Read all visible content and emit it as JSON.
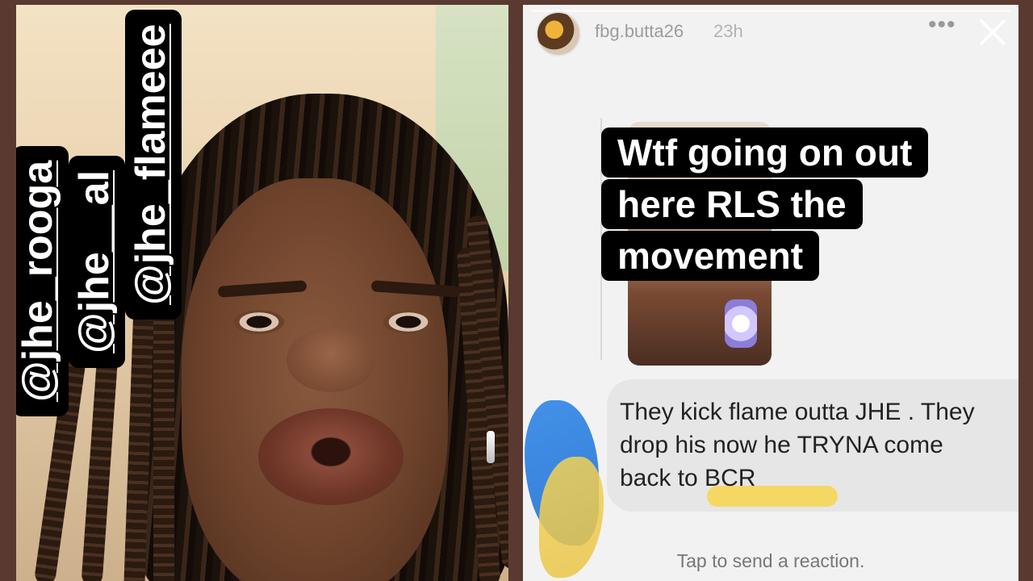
{
  "left_panel": {
    "tags": [
      "@jhe_rooga",
      "@jhe__al",
      "@jhe_flameee"
    ]
  },
  "story": {
    "username": "fbg.butta26",
    "time": "23h",
    "more_icon": "more-horizontal-icon",
    "close_icon": "close-icon",
    "caption_lines": [
      "Wtf going on out",
      "here RLS the",
      "movement"
    ],
    "message": "They kick flame outta JHE . They\ndrop his now he TRYNA come\nback to BCR",
    "reaction_prompt": "Tap to send a reaction."
  }
}
